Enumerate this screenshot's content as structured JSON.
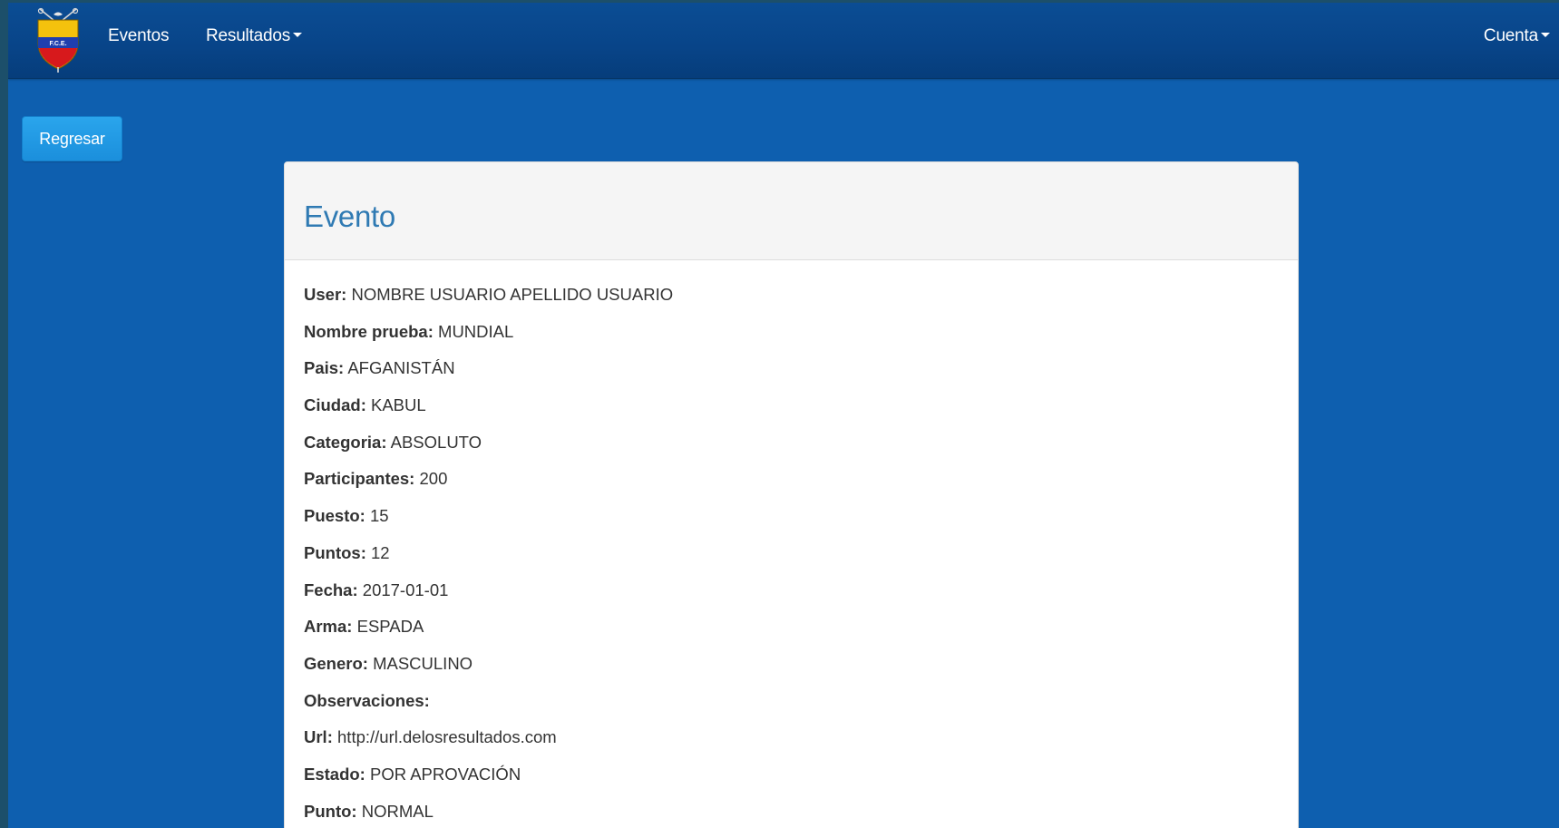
{
  "navbar": {
    "logo_text": "F.C.E.",
    "items": [
      {
        "label": "Eventos"
      },
      {
        "label": "Resultados"
      }
    ],
    "account_label": "Cuenta"
  },
  "actions": {
    "back_label": "Regresar"
  },
  "panel": {
    "title": "Evento",
    "fields": [
      {
        "label": "User:",
        "value": "NOMBRE USUARIO APELLIDO USUARIO"
      },
      {
        "label": "Nombre prueba:",
        "value": "MUNDIAL"
      },
      {
        "label": "Pais:",
        "value": "AFGANISTÁN"
      },
      {
        "label": "Ciudad:",
        "value": "KABUL"
      },
      {
        "label": "Categoria:",
        "value": "ABSOLUTO"
      },
      {
        "label": "Participantes:",
        "value": "200"
      },
      {
        "label": "Puesto:",
        "value": "15"
      },
      {
        "label": "Puntos:",
        "value": "12"
      },
      {
        "label": "Fecha:",
        "value": "2017-01-01"
      },
      {
        "label": "Arma:",
        "value": "ESPADA"
      },
      {
        "label": "Genero:",
        "value": "MASCULINO"
      },
      {
        "label": "Observaciones:",
        "value": ""
      },
      {
        "label": "Url:",
        "value": "http://url.delosresultados.com"
      },
      {
        "label": "Estado:",
        "value": "POR APROVACIÓN"
      },
      {
        "label": "Punto:",
        "value": "NORMAL"
      }
    ]
  },
  "colors": {
    "navbar": "#084488",
    "background": "#0e5faf",
    "button": "#1b8fdc",
    "title": "#2f7ab3"
  }
}
